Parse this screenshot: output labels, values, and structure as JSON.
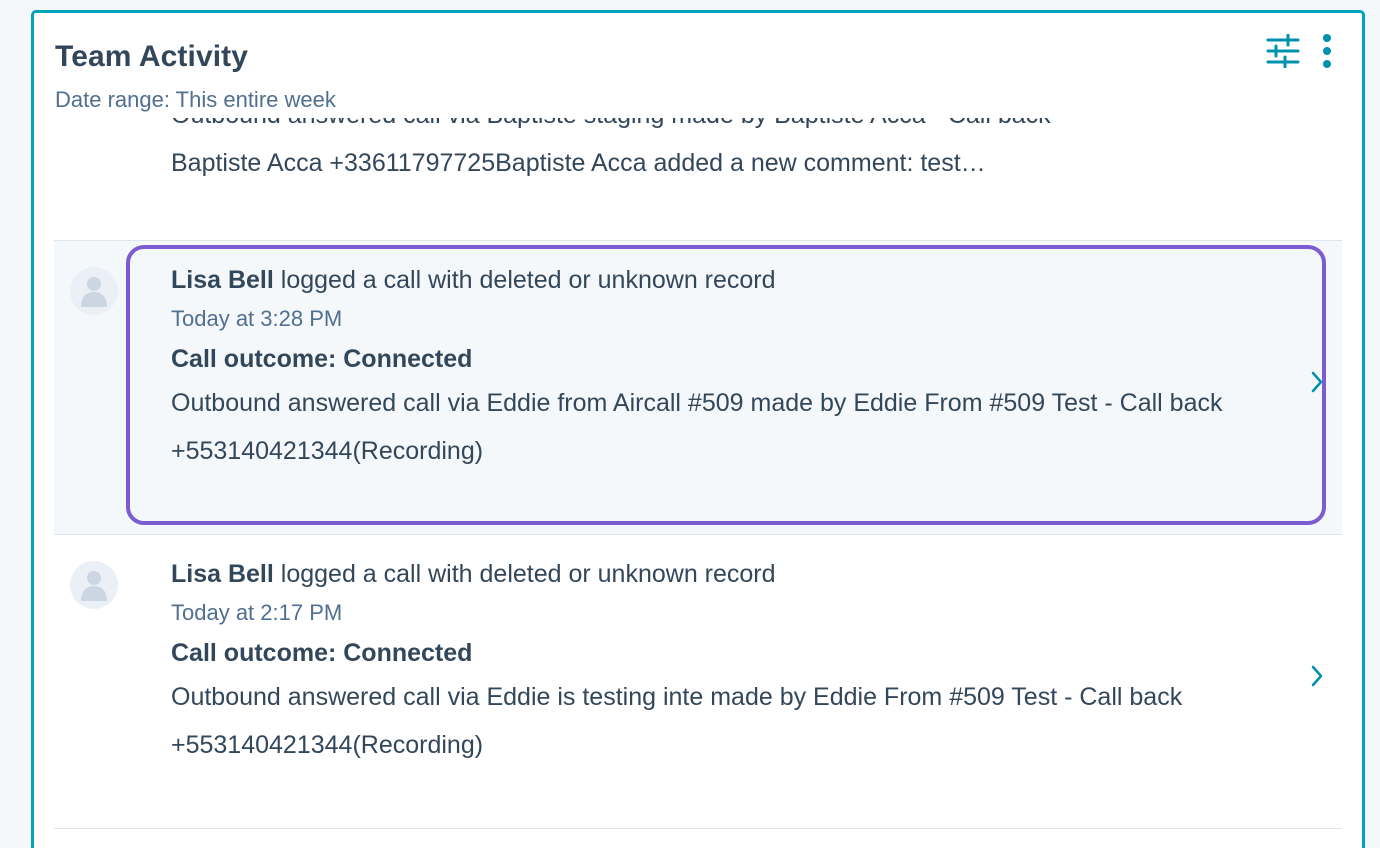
{
  "card": {
    "title": "Team Activity",
    "subtitle": "Date range: This entire week",
    "actions": {
      "filter_icon": "sliders-icon",
      "more_icon": "vertical-ellipsis-icon"
    }
  },
  "feed": {
    "partial_item": {
      "line1": "Outbound answered call via Baptiste staging made by Baptiste Acca - Call back",
      "line2": "Baptiste Acca +33611797725Baptiste Acca added a new comment: test…"
    },
    "items": [
      {
        "actor": "Lisa Bell",
        "action": "logged a call with deleted or unknown record",
        "timestamp": "Today at 3:28 PM",
        "outcome": "Call outcome: Connected",
        "description": "Outbound answered call via Eddie from Aircall #509 made by Eddie From #509 Test - Call back +553140421344(Recording)"
      },
      {
        "actor": "Lisa Bell",
        "action": "logged a call with deleted or unknown record",
        "timestamp": "Today at 2:17 PM",
        "outcome": "Call outcome: Connected",
        "description": "Outbound answered call via Eddie is testing inte made by Eddie From #509 Test - Call back +553140421344(Recording)"
      }
    ]
  },
  "colors": {
    "accent": "#00a4bd",
    "focus_ring": "#7c5cd1",
    "text_primary": "#33475b",
    "text_secondary": "#516f90",
    "highlight_bg": "#f5f8fa"
  }
}
